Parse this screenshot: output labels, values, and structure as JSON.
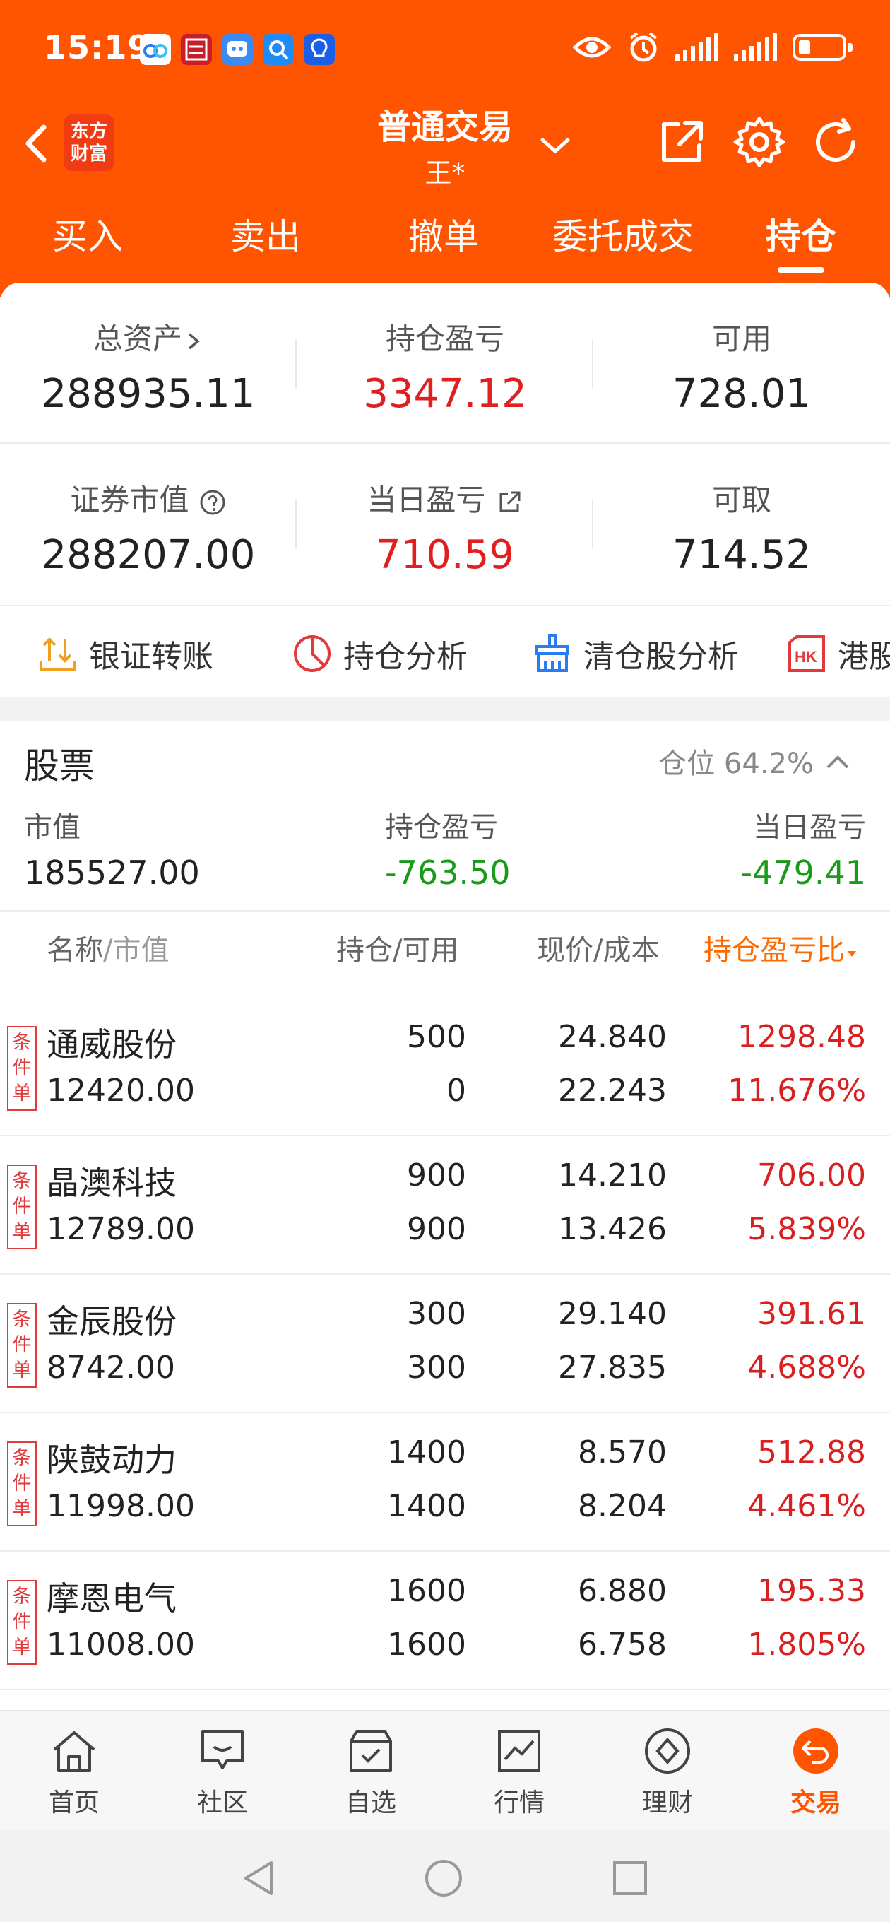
{
  "status_bar": {
    "time": "15:19",
    "notification_icons": [
      "baidu-netdisk-icon",
      "app-news-icon",
      "chat-robot-icon",
      "search-app-icon",
      "idea-app-icon"
    ],
    "right_icons": [
      "eye-comfort-icon",
      "alarm-icon",
      "signal-icon",
      "signal-icon",
      "battery-icon"
    ]
  },
  "header": {
    "logo": "东方财富",
    "title": "普通交易",
    "account": "王*",
    "tabs": [
      "买入",
      "卖出",
      "撤单",
      "委托成交",
      "持仓"
    ],
    "active_tab": 4,
    "bg_color": "#ff5500"
  },
  "summary": {
    "total_assets_label": "总资产",
    "total_assets": "288935.11",
    "holding_pl_label": "持仓盈亏",
    "holding_pl": "3347.12",
    "available_label": "可用",
    "available": "728.01",
    "market_value_label": "证券市值",
    "market_value": "288207.00",
    "daily_pl_label": "当日盈亏",
    "daily_pl": "710.59",
    "withdrawable_label": "可取",
    "withdrawable": "714.52"
  },
  "quick_actions": [
    {
      "label": "银证转账",
      "icon": "transfer-icon"
    },
    {
      "label": "持仓分析",
      "icon": "pie-chart-icon"
    },
    {
      "label": "清仓股分析",
      "icon": "broom-icon"
    },
    {
      "label": "港股",
      "icon": "hk-icon"
    }
  ],
  "stocks": {
    "title": "股票",
    "position_ratio": "仓位 64.2%",
    "market_value_label": "市值",
    "market_value": "185527.00",
    "holding_pl_label": "持仓盈亏",
    "holding_pl": "-763.50",
    "daily_pl_label": "当日盈亏",
    "daily_pl": "-479.41",
    "columns": {
      "name": "名称",
      "name_sub": "/市值",
      "qty": "持仓/可用",
      "price": "现价/成本",
      "pl": "持仓盈亏比"
    },
    "badge": "条件单",
    "rows": [
      {
        "name": "通威股份",
        "market_value": "12420.00",
        "qty": "500",
        "available": "0",
        "price": "24.840",
        "cost": "22.243",
        "pl": "1298.48",
        "pl_ratio": "11.676%"
      },
      {
        "name": "晶澳科技",
        "market_value": "12789.00",
        "qty": "900",
        "available": "900",
        "price": "14.210",
        "cost": "13.426",
        "pl": "706.00",
        "pl_ratio": "5.839%"
      },
      {
        "name": "金辰股份",
        "market_value": "8742.00",
        "qty": "300",
        "available": "300",
        "price": "29.140",
        "cost": "27.835",
        "pl": "391.61",
        "pl_ratio": "4.688%"
      },
      {
        "name": "陕鼓动力",
        "market_value": "11998.00",
        "qty": "1400",
        "available": "1400",
        "price": "8.570",
        "cost": "8.204",
        "pl": "512.88",
        "pl_ratio": "4.461%"
      },
      {
        "name": "摩恩电气",
        "market_value": "11008.00",
        "qty": "1600",
        "available": "1600",
        "price": "6.880",
        "cost": "6.758",
        "pl": "195.33",
        "pl_ratio": "1.805%"
      }
    ]
  },
  "bottom_nav": [
    {
      "label": "首页",
      "icon": "home-icon"
    },
    {
      "label": "社区",
      "icon": "chat-icon"
    },
    {
      "label": "自选",
      "icon": "watchlist-icon"
    },
    {
      "label": "行情",
      "icon": "market-chart-icon"
    },
    {
      "label": "理财",
      "icon": "wealth-icon"
    },
    {
      "label": "交易",
      "icon": "trade-icon"
    }
  ],
  "colors": {
    "accent": "#ff5500",
    "gain": "#d82020",
    "loss": "#1a9a1a"
  }
}
